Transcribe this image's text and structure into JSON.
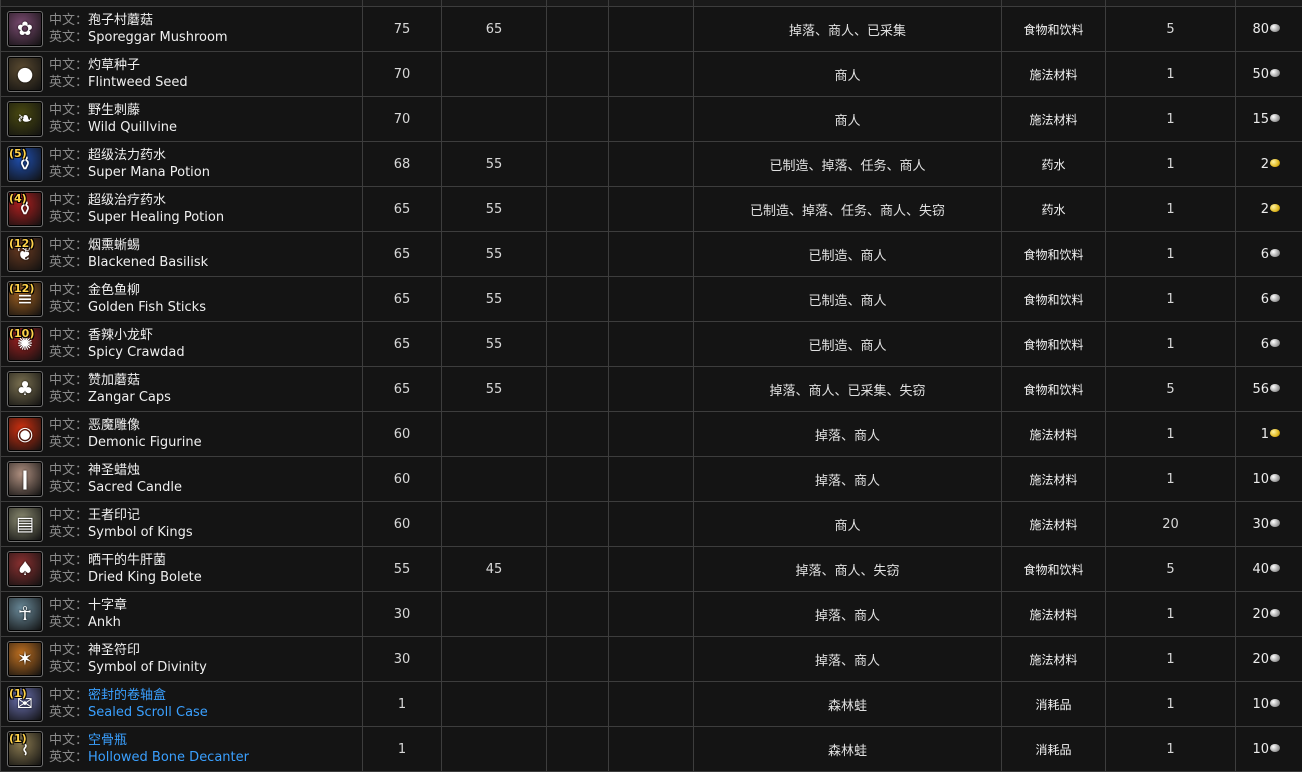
{
  "labels": {
    "cn": "中文：",
    "en": "英文："
  },
  "rows": [
    {
      "icon": "mushroom-icon",
      "icon_color": "#7a4a70",
      "glyph": "✿",
      "stack": "",
      "cn": "孢子村蘑菇",
      "en": "Sporeggar Mushroom",
      "req": "75",
      "lvl": "65",
      "col3": "",
      "col4": "",
      "source": "掉落、商人、已采集",
      "category": "食物和饮料",
      "qty": "5",
      "price": "80",
      "coin": "silver",
      "link": false
    },
    {
      "icon": "seed-icon",
      "icon_color": "#5a4a30",
      "glyph": "●",
      "stack": "",
      "cn": "灼草种子",
      "en": "Flintweed Seed",
      "req": "70",
      "lvl": "",
      "col3": "",
      "col4": "",
      "source": "商人",
      "category": "施法材料",
      "qty": "1",
      "price": "50",
      "coin": "silver",
      "link": false
    },
    {
      "icon": "vine-icon",
      "icon_color": "#4a4a10",
      "glyph": "❧",
      "stack": "",
      "cn": "野生刺藤",
      "en": "Wild Quillvine",
      "req": "70",
      "lvl": "",
      "col3": "",
      "col4": "",
      "source": "商人",
      "category": "施法材料",
      "qty": "1",
      "price": "15",
      "coin": "silver",
      "link": false
    },
    {
      "icon": "blue-potion-icon",
      "icon_color": "#1f4fb0",
      "glyph": "⚱",
      "stack": "(5)",
      "cn": "超级法力药水",
      "en": "Super Mana Potion",
      "req": "68",
      "lvl": "55",
      "col3": "",
      "col4": "",
      "source": "已制造、掉落、任务、商人",
      "category": "药水",
      "qty": "1",
      "price": "2",
      "coin": "gold",
      "link": false
    },
    {
      "icon": "red-potion-icon",
      "icon_color": "#b01f1f",
      "glyph": "⚱",
      "stack": "(4)",
      "cn": "超级治疗药水",
      "en": "Super Healing Potion",
      "req": "65",
      "lvl": "55",
      "col3": "",
      "col4": "",
      "source": "已制造、掉落、任务、商人、失窃",
      "category": "药水",
      "qty": "1",
      "price": "2",
      "coin": "gold",
      "link": false
    },
    {
      "icon": "meat-icon",
      "icon_color": "#6a3a20",
      "glyph": "❦",
      "stack": "(12)",
      "cn": "烟熏蜥蜴",
      "en": "Blackened Basilisk",
      "req": "65",
      "lvl": "55",
      "col3": "",
      "col4": "",
      "source": "已制造、商人",
      "category": "食物和饮料",
      "qty": "1",
      "price": "6",
      "coin": "silver",
      "link": false
    },
    {
      "icon": "fish-sticks-icon",
      "icon_color": "#a06020",
      "glyph": "≡",
      "stack": "(12)",
      "cn": "金色鱼柳",
      "en": "Golden Fish Sticks",
      "req": "65",
      "lvl": "55",
      "col3": "",
      "col4": "",
      "source": "已制造、商人",
      "category": "食物和饮料",
      "qty": "1",
      "price": "6",
      "coin": "silver",
      "link": false
    },
    {
      "icon": "crawdad-icon",
      "icon_color": "#a02020",
      "glyph": "✺",
      "stack": "(10)",
      "cn": "香辣小龙虾",
      "en": "Spicy Crawdad",
      "req": "65",
      "lvl": "55",
      "col3": "",
      "col4": "",
      "source": "已制造、商人",
      "category": "食物和饮料",
      "qty": "1",
      "price": "6",
      "coin": "silver",
      "link": false
    },
    {
      "icon": "mushroom-caps-icon",
      "icon_color": "#7a7050",
      "glyph": "♣",
      "stack": "",
      "cn": "赞加蘑菇",
      "en": "Zangar Caps",
      "req": "65",
      "lvl": "55",
      "col3": "",
      "col4": "",
      "source": "掉落、商人、已采集、失窃",
      "category": "食物和饮料",
      "qty": "5",
      "price": "56",
      "coin": "silver",
      "link": false
    },
    {
      "icon": "demonic-figurine-icon",
      "icon_color": "#d03010",
      "glyph": "◉",
      "stack": "",
      "cn": "恶魔雕像",
      "en": "Demonic Figurine",
      "req": "60",
      "lvl": "",
      "col3": "",
      "col4": "",
      "source": "掉落、商人",
      "category": "施法材料",
      "qty": "1",
      "price": "1",
      "coin": "gold",
      "link": false
    },
    {
      "icon": "candle-icon",
      "icon_color": "#b09080",
      "glyph": "❙",
      "stack": "",
      "cn": "神圣蜡烛",
      "en": "Sacred Candle",
      "req": "60",
      "lvl": "",
      "col3": "",
      "col4": "",
      "source": "掉落、商人",
      "category": "施法材料",
      "qty": "1",
      "price": "10",
      "coin": "silver",
      "link": false
    },
    {
      "icon": "symbol-kings-icon",
      "icon_color": "#8a8a70",
      "glyph": "▤",
      "stack": "",
      "cn": "王者印记",
      "en": "Symbol of Kings",
      "req": "60",
      "lvl": "",
      "col3": "",
      "col4": "",
      "source": "商人",
      "category": "施法材料",
      "qty": "20",
      "price": "30",
      "coin": "silver",
      "link": false
    },
    {
      "icon": "bolete-icon",
      "icon_color": "#8a3030",
      "glyph": "♠",
      "stack": "",
      "cn": "晒干的牛肝菌",
      "en": "Dried King Bolete",
      "req": "55",
      "lvl": "45",
      "col3": "",
      "col4": "",
      "source": "掉落、商人、失窃",
      "category": "食物和饮料",
      "qty": "5",
      "price": "40",
      "coin": "silver",
      "link": false
    },
    {
      "icon": "ankh-icon",
      "icon_color": "#6a8a9a",
      "glyph": "☥",
      "stack": "",
      "cn": "十字章",
      "en": "Ankh",
      "req": "30",
      "lvl": "",
      "col3": "",
      "col4": "",
      "source": "掉落、商人",
      "category": "施法材料",
      "qty": "1",
      "price": "20",
      "coin": "silver",
      "link": false
    },
    {
      "icon": "symbol-divinity-icon",
      "icon_color": "#c07020",
      "glyph": "✶",
      "stack": "",
      "cn": "神圣符印",
      "en": "Symbol of Divinity",
      "req": "30",
      "lvl": "",
      "col3": "",
      "col4": "",
      "source": "掉落、商人",
      "category": "施法材料",
      "qty": "1",
      "price": "20",
      "coin": "silver",
      "link": false
    },
    {
      "icon": "scroll-case-icon",
      "icon_color": "#6a70b0",
      "glyph": "✉",
      "stack": "(1)",
      "cn": "密封的卷轴盒",
      "en": "Sealed Scroll Case",
      "req": "1",
      "lvl": "",
      "col3": "",
      "col4": "",
      "source": "森林蛙",
      "category": "消耗品",
      "qty": "1",
      "price": "10",
      "coin": "silver",
      "link": true
    },
    {
      "icon": "bone-decanter-icon",
      "icon_color": "#8a7a50",
      "glyph": "⌇",
      "stack": "(1)",
      "cn": "空骨瓶",
      "en": "Hollowed Bone Decanter",
      "req": "1",
      "lvl": "",
      "col3": "",
      "col4": "",
      "source": "森林蛙",
      "category": "消耗品",
      "qty": "1",
      "price": "10",
      "coin": "silver",
      "link": true
    }
  ]
}
